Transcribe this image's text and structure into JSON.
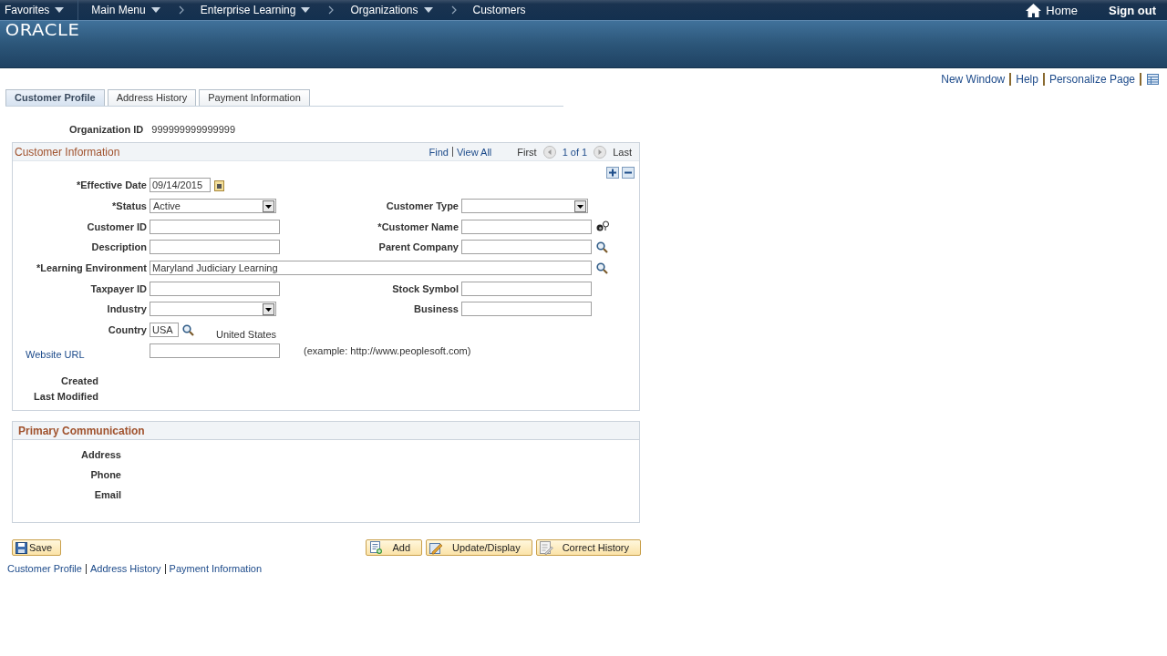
{
  "nav": {
    "items": [
      {
        "label": "Favorites",
        "kind": "menu"
      },
      {
        "label": "Main Menu",
        "kind": "menu"
      },
      {
        "label": "Enterprise Learning",
        "kind": "menu"
      },
      {
        "label": "Organizations",
        "kind": "menu"
      },
      {
        "label": "Customers",
        "kind": "page"
      }
    ],
    "home": "Home",
    "signout": "Sign out"
  },
  "brand": {
    "logo": "ORACLE"
  },
  "page_links": [
    "New Window",
    "Help",
    "Personalize Page"
  ],
  "tabs": [
    {
      "label": "Customer Profile",
      "selected": true
    },
    {
      "label": "Address History",
      "selected": false
    },
    {
      "label": "Payment Information",
      "selected": false
    }
  ],
  "key_field": {
    "label": "Organization ID",
    "value": "999999999999999"
  },
  "customer_information": {
    "title": "Customer Information",
    "links": [
      "Find",
      "View All"
    ],
    "first": "First",
    "position": "1 of 1",
    "last": "Last",
    "rows": [
      {
        "left": {
          "label": "*Effective Date",
          "kind": "date",
          "value": "09/14/2015"
        }
      },
      {
        "left": {
          "label": "*Status",
          "kind": "select",
          "value": "Active"
        },
        "right": {
          "label": "Customer Type",
          "kind": "select"
        }
      },
      {
        "left": {
          "label": "Customer ID",
          "kind": "text"
        },
        "right": {
          "label": "*Customer Name",
          "kind": "prompt"
        }
      },
      {
        "left": {
          "label": "Description",
          "kind": "text"
        },
        "right": {
          "label": "Parent Company",
          "kind": "lookup"
        }
      },
      {
        "left": {
          "label": "*Learning Environment",
          "kind": "wide",
          "value": "Maryland Judiciary Learning"
        }
      },
      {
        "left": {
          "label": "Taxpayer ID",
          "kind": "text"
        },
        "right": {
          "label": "Stock Symbol",
          "kind": "text"
        }
      },
      {
        "left": {
          "label": "Industry",
          "kind": "select"
        },
        "right": {
          "label": "Business",
          "kind": "text"
        }
      },
      {
        "left": {
          "label": "Country",
          "kind": "country",
          "value": "USA",
          "description": "United States"
        }
      },
      {
        "left": {
          "label": "Website URL",
          "kind": "url",
          "hint": "(example: http://www.peoplesoft.com)"
        }
      }
    ],
    "audit": [
      "Created",
      "Last Modified"
    ]
  },
  "primary_communication": {
    "title": "Primary Communication",
    "labels": [
      "Address",
      "Phone",
      "Email"
    ]
  },
  "buttons": {
    "save": "Save",
    "actions": [
      {
        "label": "Add",
        "kind": "add"
      },
      {
        "label": "Update/Display",
        "kind": "update"
      },
      {
        "label": "Correct History",
        "kind": "correct"
      }
    ]
  },
  "footer_links": [
    "Customer Profile",
    "Address History",
    "Payment Information"
  ]
}
